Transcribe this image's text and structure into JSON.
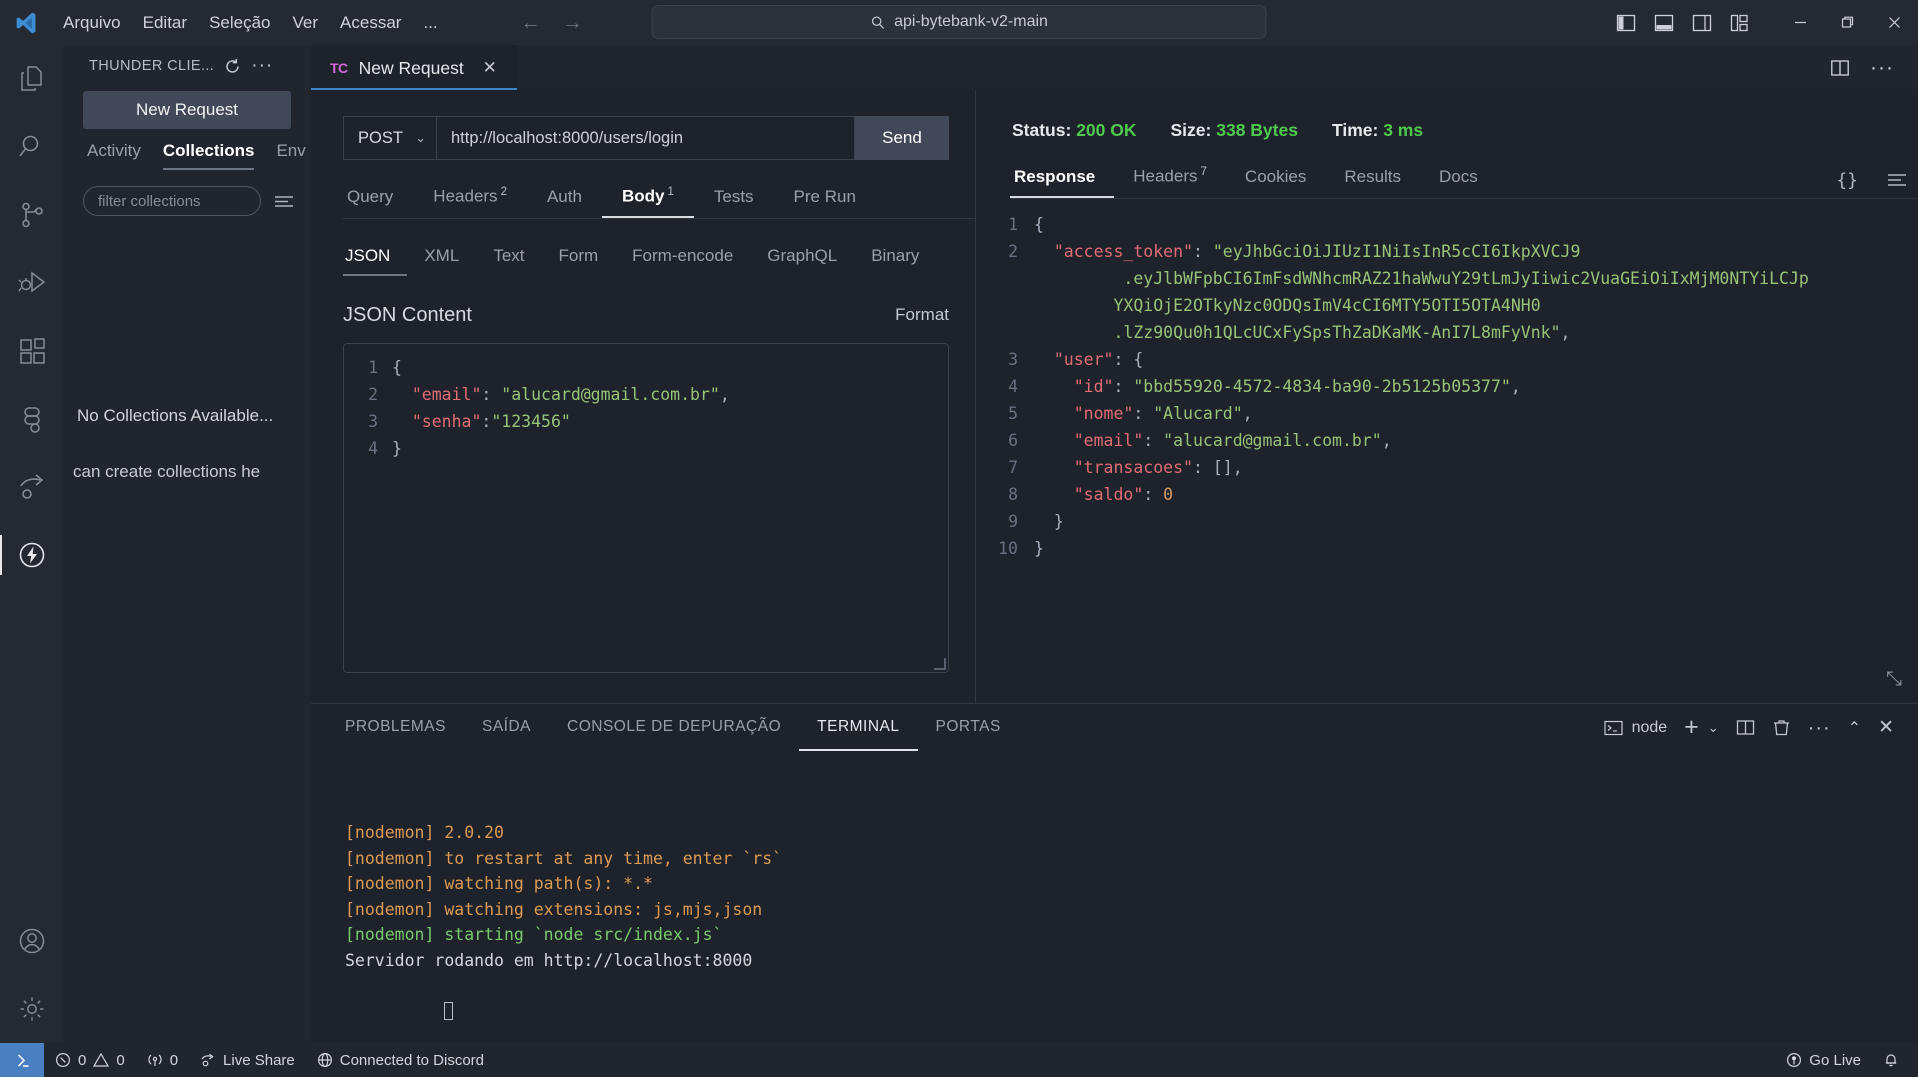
{
  "titlebar": {
    "menus": [
      "Arquivo",
      "Editar",
      "Seleção",
      "Ver",
      "Acessar",
      "..."
    ],
    "command_center_text": "api-bytebank-v2-main",
    "nav_back": "←",
    "nav_forward": "→",
    "window_controls": {
      "minimize": "—",
      "restore": "❐",
      "close": "✕"
    }
  },
  "activity_bar": {
    "items": [
      {
        "name": "explorer",
        "label": "Explorer"
      },
      {
        "name": "search",
        "label": "Search"
      },
      {
        "name": "source-control",
        "label": "Source Control"
      },
      {
        "name": "run-debug",
        "label": "Run and Debug"
      },
      {
        "name": "extensions",
        "label": "Extensions"
      },
      {
        "name": "figma",
        "label": "Figma"
      },
      {
        "name": "live-share",
        "label": "Live Share"
      },
      {
        "name": "thunder-client",
        "label": "Thunder Client"
      }
    ],
    "bottom": [
      {
        "name": "accounts",
        "label": "Accounts"
      },
      {
        "name": "manage-settings",
        "label": "Manage"
      }
    ]
  },
  "sidebar": {
    "title": "THUNDER CLIE...",
    "refresh_icon": "refresh-icon",
    "more_icon": "more-icon",
    "new_request_label": "New Request",
    "tabs": [
      {
        "label": "Activity",
        "active": false
      },
      {
        "label": "Collections",
        "active": true
      },
      {
        "label": "Env",
        "active": false
      }
    ],
    "filter_placeholder": "filter collections",
    "empty_title": "No Collections Available...",
    "empty_subtitle": "can create collections he"
  },
  "editor_tabs": [
    {
      "icon": "TC",
      "label": "New Request",
      "active": true,
      "close": "✕"
    }
  ],
  "editor_tabbar_actions": [
    "split-editor-icon",
    "more-actions-icon"
  ],
  "request": {
    "method": "POST",
    "method_chevron": "⌄",
    "url": "http://localhost:8000/users/login",
    "send_label": "Send",
    "tabs": [
      {
        "label": "Query",
        "badge": "",
        "active": false
      },
      {
        "label": "Headers",
        "badge": "2",
        "active": false
      },
      {
        "label": "Auth",
        "badge": "",
        "active": false
      },
      {
        "label": "Body",
        "badge": "1",
        "active": true
      },
      {
        "label": "Tests",
        "badge": "",
        "active": false
      },
      {
        "label": "Pre Run",
        "badge": "",
        "active": false
      }
    ],
    "body_types": [
      {
        "label": "JSON",
        "active": true
      },
      {
        "label": "XML",
        "active": false
      },
      {
        "label": "Text",
        "active": false
      },
      {
        "label": "Form",
        "active": false
      },
      {
        "label": "Form-encode",
        "active": false
      },
      {
        "label": "GraphQL",
        "active": false
      },
      {
        "label": "Binary",
        "active": false
      }
    ],
    "json_content_label": "JSON Content",
    "format_label": "Format",
    "body_lines": [
      {
        "n": "1",
        "parts": [
          {
            "t": "{",
            "c": "punct"
          }
        ]
      },
      {
        "n": "2",
        "parts": [
          {
            "t": "  \"email\"",
            "c": "key"
          },
          {
            "t": ": ",
            "c": "punct"
          },
          {
            "t": "\"alucard@gmail.com.br\"",
            "c": "str"
          },
          {
            "t": ",",
            "c": "punct"
          }
        ]
      },
      {
        "n": "3",
        "parts": [
          {
            "t": "  \"senha\"",
            "c": "key"
          },
          {
            "t": ":",
            "c": "punct"
          },
          {
            "t": "\"123456\"",
            "c": "str"
          }
        ]
      },
      {
        "n": "4",
        "parts": [
          {
            "t": "}",
            "c": "punct"
          }
        ]
      }
    ]
  },
  "response": {
    "status_label": "Status:",
    "status_value": "200 OK",
    "size_label": "Size:",
    "size_value": "338 Bytes",
    "time_label": "Time:",
    "time_value": "3 ms",
    "tabs": [
      {
        "label": "Response",
        "badge": "",
        "active": true
      },
      {
        "label": "Headers",
        "badge": "7",
        "active": false
      },
      {
        "label": "Cookies",
        "badge": "",
        "active": false
      },
      {
        "label": "Results",
        "badge": "",
        "active": false
      },
      {
        "label": "Docs",
        "badge": "",
        "active": false
      }
    ],
    "actions": {
      "braces": "{}",
      "menu_icon": "list-menu-icon"
    },
    "body_lines": [
      {
        "n": "1",
        "parts": [
          {
            "t": "{",
            "c": "punct"
          }
        ]
      },
      {
        "n": "2",
        "parts": [
          {
            "t": "  \"access_token\"",
            "c": "key"
          },
          {
            "t": ": ",
            "c": "punct"
          },
          {
            "t": "\"eyJhbGciOiJIUzI1NiIsInR5cCI6IkpXVCJ9",
            "c": "str"
          }
        ]
      },
      {
        "n": "",
        "parts": [
          {
            "t": "         .eyJlbWFpbCI6ImFsdWNhcmRAZ21haWwuY29tLmJyIiwic2VuaGEiOiIxMjM0NTYiLCJp",
            "c": "str"
          }
        ]
      },
      {
        "n": "",
        "parts": [
          {
            "t": "        YXQiOjE2OTkyNzc0ODQsImV4cCI6MTY5OTI5OTA4NH0",
            "c": "str"
          }
        ]
      },
      {
        "n": "",
        "parts": [
          {
            "t": "        .lZz90Qu0h1QLcUCxFySpsThZaDKaMK-AnI7L8mFyVnk\"",
            "c": "str"
          },
          {
            "t": ",",
            "c": "punct"
          }
        ]
      },
      {
        "n": "3",
        "parts": [
          {
            "t": "  \"user\"",
            "c": "key"
          },
          {
            "t": ": {",
            "c": "punct"
          }
        ]
      },
      {
        "n": "4",
        "parts": [
          {
            "t": "    \"id\"",
            "c": "key"
          },
          {
            "t": ": ",
            "c": "punct"
          },
          {
            "t": "\"bbd55920-4572-4834-ba90-2b5125b05377\"",
            "c": "str"
          },
          {
            "t": ",",
            "c": "punct"
          }
        ]
      },
      {
        "n": "5",
        "parts": [
          {
            "t": "    \"nome\"",
            "c": "key"
          },
          {
            "t": ": ",
            "c": "punct"
          },
          {
            "t": "\"Alucard\"",
            "c": "str"
          },
          {
            "t": ",",
            "c": "punct"
          }
        ]
      },
      {
        "n": "6",
        "parts": [
          {
            "t": "    \"email\"",
            "c": "key"
          },
          {
            "t": ": ",
            "c": "punct"
          },
          {
            "t": "\"alucard@gmail.com.br\"",
            "c": "str"
          },
          {
            "t": ",",
            "c": "punct"
          }
        ]
      },
      {
        "n": "7",
        "parts": [
          {
            "t": "    \"transacoes\"",
            "c": "key"
          },
          {
            "t": ": [],",
            "c": "punct"
          }
        ]
      },
      {
        "n": "8",
        "parts": [
          {
            "t": "    \"saldo\"",
            "c": "key"
          },
          {
            "t": ": ",
            "c": "punct"
          },
          {
            "t": "0",
            "c": "num"
          }
        ]
      },
      {
        "n": "9",
        "parts": [
          {
            "t": "  }",
            "c": "punct"
          }
        ]
      },
      {
        "n": "10",
        "parts": [
          {
            "t": "}",
            "c": "punct"
          }
        ]
      }
    ]
  },
  "panel": {
    "tabs": [
      {
        "label": "PROBLEMAS",
        "active": false
      },
      {
        "label": "SAÍDA",
        "active": false
      },
      {
        "label": "CONSOLE DE DEPURAÇÃO",
        "active": false
      },
      {
        "label": "TERMINAL",
        "active": true
      },
      {
        "label": "PORTAS",
        "active": false
      }
    ],
    "terminal_name": "node",
    "actions": [
      "new-terminal-icon",
      "terminal-dropdown-icon",
      "split-terminal-icon",
      "kill-terminal-icon",
      "more-actions-icon",
      "maximize-panel-icon",
      "close-panel-icon"
    ],
    "terminal_lines": [
      {
        "c": "orange",
        "t": "[nodemon] 2.0.20"
      },
      {
        "c": "orange",
        "t": "[nodemon] to restart at any time, enter `rs`"
      },
      {
        "c": "orange",
        "t": "[nodemon] watching path(s): *.*"
      },
      {
        "c": "orange",
        "t": "[nodemon] watching extensions: js,mjs,json"
      },
      {
        "c": "green",
        "t": "[nodemon] starting `node src/index.js`"
      },
      {
        "c": "white",
        "t": "Servidor rodando em http://localhost:8000"
      }
    ]
  },
  "statusbar": {
    "remote_icon": "remote-window-icon",
    "errors": "0",
    "warnings": "0",
    "ports": "0",
    "live_share": "Live Share",
    "discord": "Connected to Discord",
    "go_live": "Go Live",
    "bell_icon": "notifications-bell-icon"
  },
  "colors": {
    "accent": "#4a7fc1",
    "success": "#4ec94e",
    "tab_indicator": "#3e86c9",
    "thunder_pink": "#cf6ad9"
  }
}
